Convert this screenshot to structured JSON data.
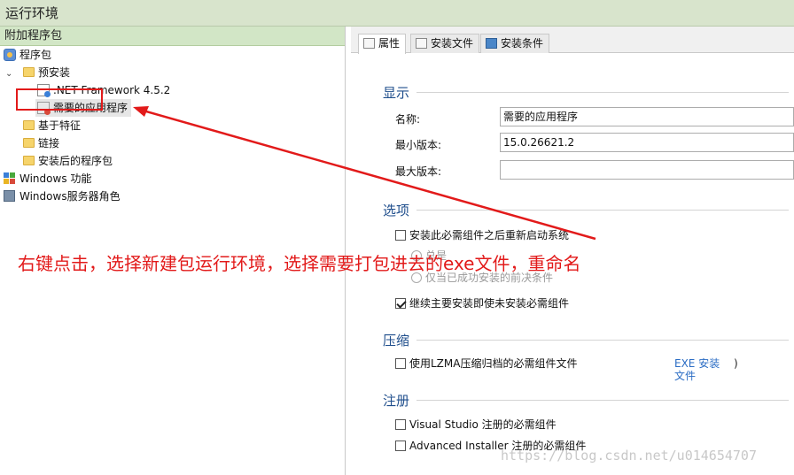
{
  "window": {
    "title": "运行环境"
  },
  "left_panel": {
    "header": "附加程序包",
    "tree": [
      {
        "label": "程序包",
        "icon": "package-icon",
        "level": 0
      },
      {
        "label": "预安装",
        "icon": "folder-icon",
        "level": 1,
        "expanded": true
      },
      {
        "label": ".NET Framework 4.5.2",
        "icon": "dotnet-component-icon",
        "level": 2
      },
      {
        "label": "需要的应用程序",
        "icon": "application-package-icon",
        "level": 2,
        "selected": true
      },
      {
        "label": "基于特征",
        "icon": "folder-icon",
        "level": 1
      },
      {
        "label": "链接",
        "icon": "folder-icon",
        "level": 1
      },
      {
        "label": "安装后的程序包",
        "icon": "folder-icon",
        "level": 1
      },
      {
        "label": "Windows 功能",
        "icon": "windows-features-icon",
        "level": 0
      },
      {
        "label": "Windows服务器角色",
        "icon": "windows-server-roles-icon",
        "level": 0
      }
    ]
  },
  "tabs": [
    {
      "label": "属性",
      "active": true,
      "icon": "properties-icon"
    },
    {
      "label": "安装文件",
      "active": false,
      "icon": "install-files-icon"
    },
    {
      "label": "安装条件",
      "active": false,
      "icon": "install-conditions-icon"
    }
  ],
  "display_section": {
    "title": "显示",
    "name_label": "名称:",
    "name_value": "需要的应用程序",
    "min_version_label": "最小版本:",
    "min_version_value": "15.0.26621.2",
    "max_version_label": "最大版本:",
    "max_version_value": ""
  },
  "options_section": {
    "title": "选项",
    "option1": {
      "label": "安装此必需组件之后重新启动系统",
      "checked": false
    },
    "radio1_label": "总是",
    "radio2_label": "仅当已成功安装的前决条件",
    "option2": {
      "label": "继续主要安装即使未安装必需组件",
      "checked": true
    }
  },
  "compress_section": {
    "title": "压缩",
    "option": {
      "label": "使用LZMA压缩归档的必需组件文件",
      "checked": false
    },
    "link": "EXE 安装文件",
    "link_suffix": ")"
  },
  "register_section": {
    "title": "注册",
    "option1": {
      "label": "Visual Studio 注册的必需组件",
      "checked": false
    },
    "option2": {
      "label": "Advanced Installer 注册的必需组件",
      "checked": false
    }
  },
  "annotation": {
    "text": "右键点击，选择新建包运行环境，选择需要打包进去的exe文件，重命名",
    "color": "#e21a1a"
  },
  "watermark": "https://blog.csdn.net/u014654707"
}
